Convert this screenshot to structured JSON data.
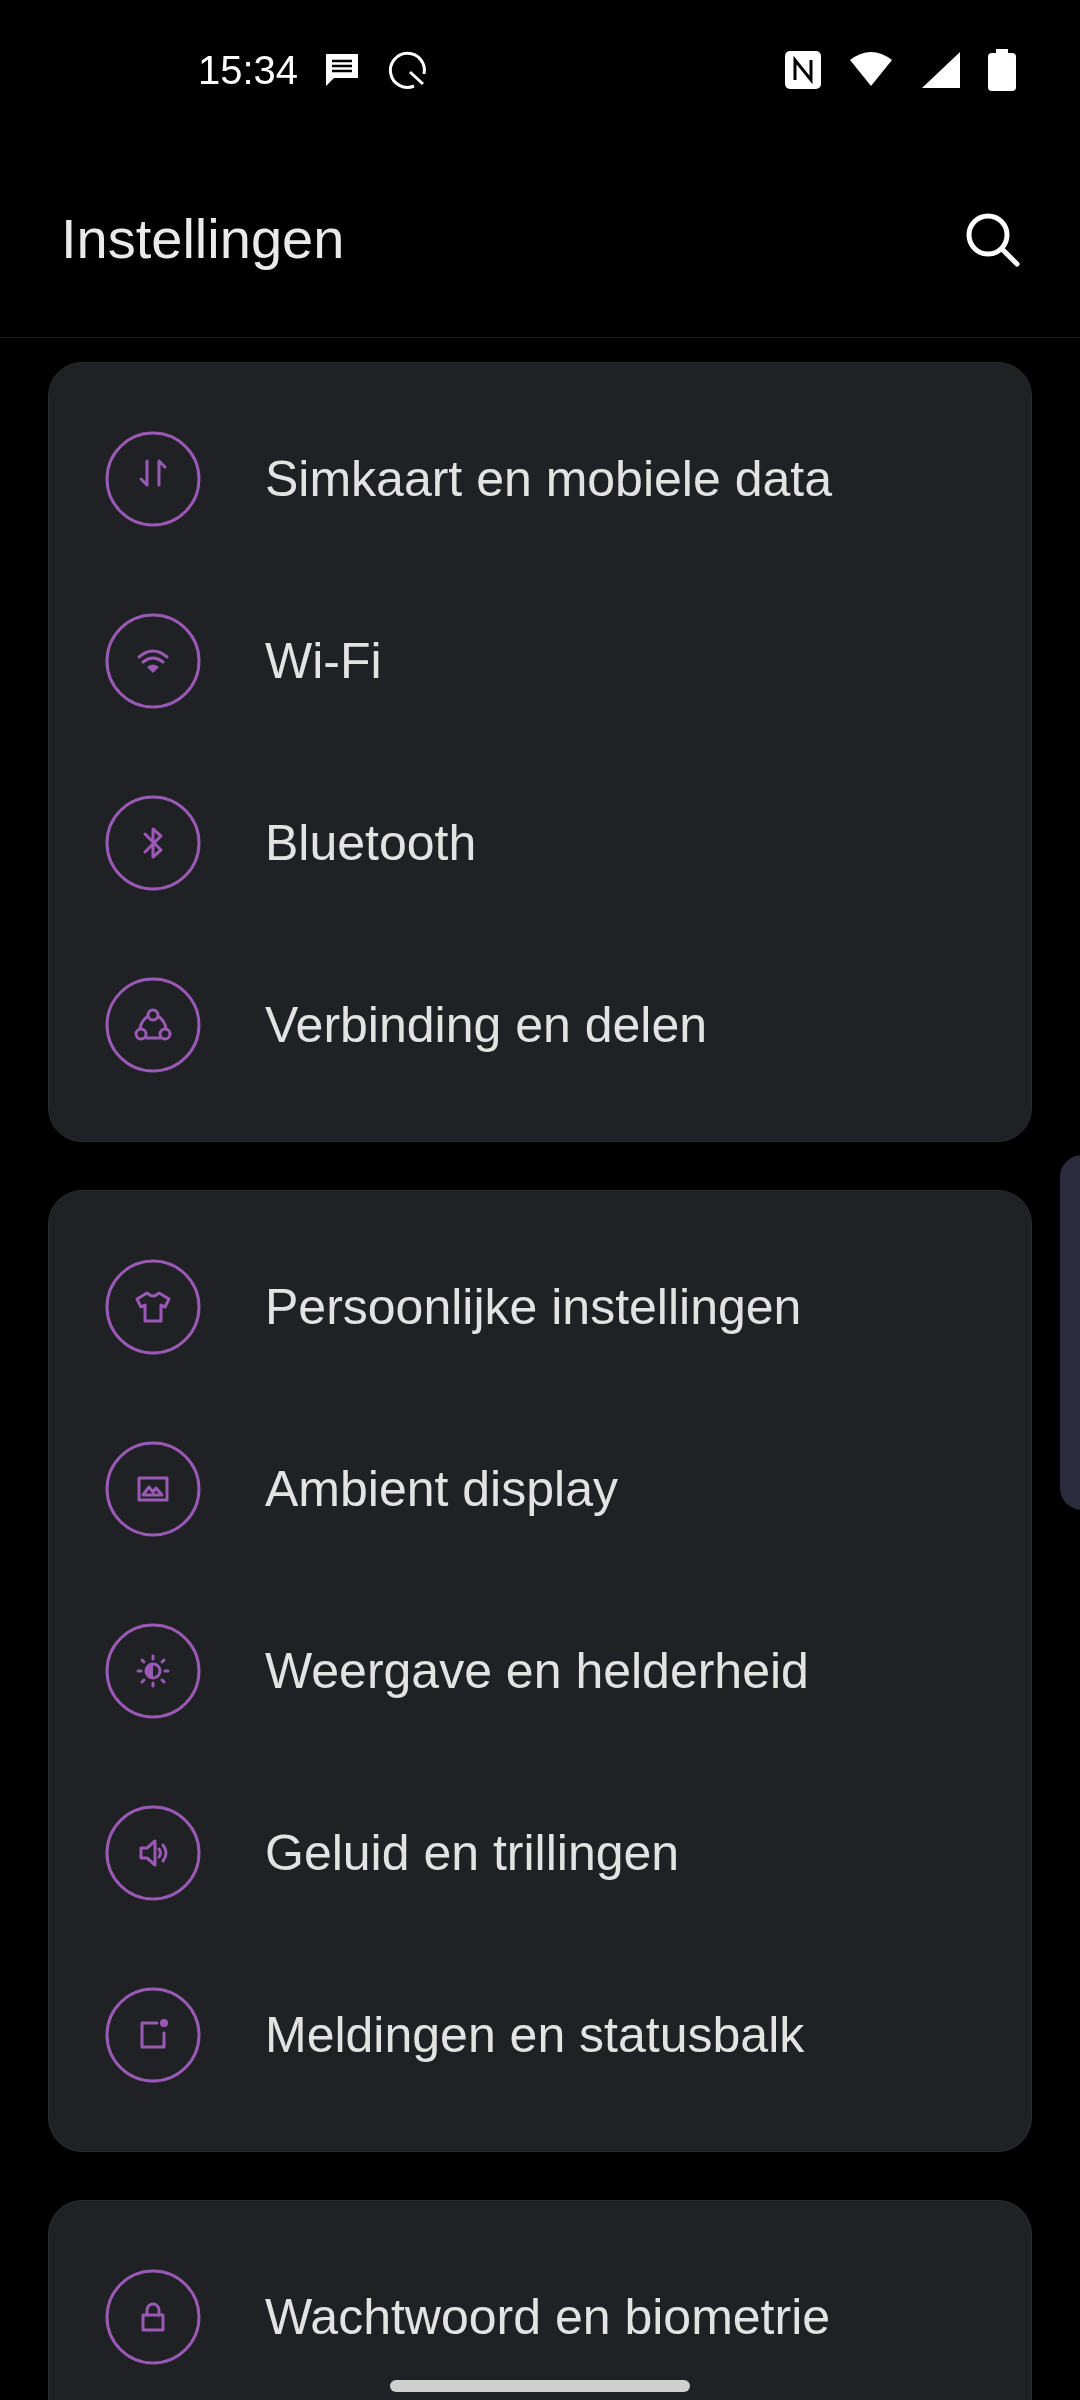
{
  "status_bar": {
    "time": "15:34"
  },
  "header": {
    "title": "Instellingen"
  },
  "groups": [
    {
      "items": [
        {
          "label": "Simkaart en mobiele data",
          "kind": "data"
        },
        {
          "label": "Wi-Fi",
          "kind": "wifi"
        },
        {
          "label": "Bluetooth",
          "kind": "bluetooth"
        },
        {
          "label": "Verbinding en delen",
          "kind": "share"
        }
      ]
    },
    {
      "items": [
        {
          "label": "Persoonlijke instellingen",
          "kind": "shirt"
        },
        {
          "label": "Ambient display",
          "kind": "image"
        },
        {
          "label": "Weergave en helderheid",
          "kind": "brightness"
        },
        {
          "label": "Geluid en trillingen",
          "kind": "sound"
        },
        {
          "label": "Meldingen en statusbalk",
          "kind": "notification"
        }
      ]
    },
    {
      "items": [
        {
          "label": "Wachtwoord en biometrie",
          "kind": "lock"
        }
      ]
    }
  ]
}
